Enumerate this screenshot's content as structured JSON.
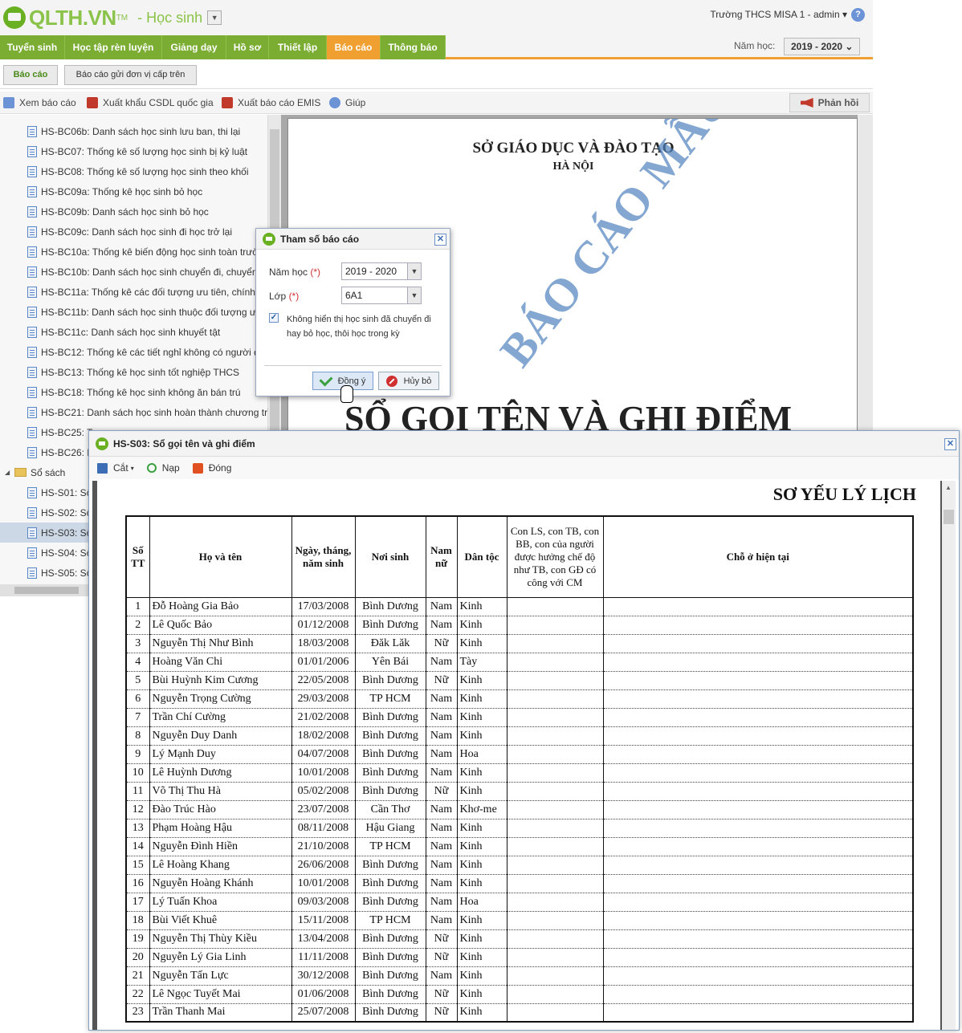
{
  "header": {
    "logo_text": "QLTH.VN",
    "logo_tm": "TM",
    "module": "- Học sinh",
    "role_caret": "▼",
    "user": "Trường THCS MISA 1 - admin ▾",
    "help": "?"
  },
  "nav": {
    "tabs": [
      {
        "label": "Tuyển sinh"
      },
      {
        "label": "Học tập rèn luyện"
      },
      {
        "label": "Giảng dạy"
      },
      {
        "label": "Hồ sơ"
      },
      {
        "label": "Thiết lập"
      },
      {
        "label": "Báo cáo"
      },
      {
        "label": "Thông báo"
      }
    ],
    "active_index": 5,
    "year_label": "Năm học:",
    "year_value": "2019 - 2020 ⌄"
  },
  "subtabs": [
    "Báo cáo",
    "Báo cáo gửi đơn vị cấp trên"
  ],
  "toolbar": {
    "view": "Xem báo cáo",
    "export_db": "Xuất khẩu CSDL quốc gia",
    "export_emis": "Xuất báo cáo EMIS",
    "help": "Giúp",
    "feedback": "Phản hồi"
  },
  "tree": {
    "items": [
      {
        "label": "HS-BC06b: Danh sách học sinh lưu ban, thi lại"
      },
      {
        "label": "HS-BC07: Thống kê số lượng học sinh bị kỷ luật"
      },
      {
        "label": "HS-BC08: Thống kê số lượng học sinh theo khối"
      },
      {
        "label": "HS-BC09a: Thống kê học sinh bỏ học"
      },
      {
        "label": "HS-BC09b: Danh sách học sinh bỏ học"
      },
      {
        "label": "HS-BC09c: Danh sách học sinh đi học trở lại"
      },
      {
        "label": "HS-BC10a: Thống kê biến động học sinh toàn trườ"
      },
      {
        "label": "HS-BC10b: Danh sách học sinh chuyển đi, chuyển"
      },
      {
        "label": "HS-BC11a: Thống kê các đối tượng ưu tiên, chính s"
      },
      {
        "label": "HS-BC11b: Danh sách học sinh thuộc đối tượng ưu"
      },
      {
        "label": "HS-BC11c: Danh sách học sinh khuyết tật"
      },
      {
        "label": "HS-BC12: Thống kê các tiết nghỉ không có người d"
      },
      {
        "label": "HS-BC13: Thống kê học sinh tốt nghiệp THCS"
      },
      {
        "label": "HS-BC18: Thống kê học sinh không ăn bán trú"
      },
      {
        "label": "HS-BC21: Danh sách học sinh hoàn thành chương trìr"
      },
      {
        "label": "HS-BC25: T"
      },
      {
        "label": "HS-BC26: D"
      }
    ],
    "folder": {
      "label": "Sổ sách",
      "toggle": "◢"
    },
    "folder_items": [
      {
        "label": "HS-S01: Số"
      },
      {
        "label": "HS-S02: Số"
      },
      {
        "label": "HS-S03: Số"
      },
      {
        "label": "HS-S04: Số"
      },
      {
        "label": "HS-S05: Số"
      }
    ],
    "selected": "HS-S03"
  },
  "preview": {
    "dept": "SỞ GIÁO DỤC VÀ ĐÀO TẠO",
    "city": "HÀ NỘI",
    "watermark": "BÁO CÁO MẪU",
    "title": "SỔ GỌI TÊN VÀ GHI ĐIỂM"
  },
  "dialog": {
    "title": "Tham số báo cáo",
    "year_label": "Năm học",
    "year_value": "2019 - 2020",
    "class_label": "Lớp",
    "class_value": "6A1",
    "required_mark": "(*)",
    "arrow": "▼",
    "checkbox_mark": "✓",
    "checkbox_text": "Không hiển thị học sinh đã chuyển đi hay bỏ học, thôi học trong kỳ",
    "ok": "Đồng ý",
    "cancel": "Hủy bỏ",
    "close": "✕"
  },
  "window": {
    "title": "HS-S03: Sổ gọi tên và ghi điểm",
    "close": "✕",
    "tools": {
      "cut": "Cắt",
      "caret": "▾",
      "load": "Nạp",
      "close": "Đóng"
    },
    "heading": "SƠ YẾU LÝ LỊCH",
    "scroll_up": "▲",
    "columns": [
      "Số TT",
      "Họ và tên",
      "Ngày, tháng, năm sinh",
      "Nơi sinh",
      "Nam nữ",
      "Dân tộc",
      "Con LS, con TB, con BB, con của người được hưởng chế độ như TB, con GĐ có công với CM",
      "Chỗ ở hiện tại"
    ],
    "rows": [
      {
        "no": "1",
        "name": "Đỗ Hoàng Gia Bảo",
        "dob": "17/03/2008",
        "place": "Bình Dương",
        "sex": "Nam",
        "eth": "Kinh"
      },
      {
        "no": "2",
        "name": "Lê Quốc Bảo",
        "dob": "01/12/2008",
        "place": "Bình Dương",
        "sex": "Nam",
        "eth": "Kinh"
      },
      {
        "no": "3",
        "name": "Nguyễn Thị Như Bình",
        "dob": "18/03/2008",
        "place": "Đăk Lăk",
        "sex": "Nữ",
        "eth": "Kinh"
      },
      {
        "no": "4",
        "name": "Hoàng Văn Chi",
        "dob": "01/01/2006",
        "place": "Yên Bái",
        "sex": "Nam",
        "eth": "Tày"
      },
      {
        "no": "5",
        "name": "Bùi Huỳnh Kim Cương",
        "dob": "22/05/2008",
        "place": "Bình Dương",
        "sex": "Nữ",
        "eth": "Kinh"
      },
      {
        "no": "6",
        "name": "Nguyễn Trọng Cường",
        "dob": "29/03/2008",
        "place": "TP HCM",
        "sex": "Nam",
        "eth": "Kinh"
      },
      {
        "no": "7",
        "name": "Trần Chí Cường",
        "dob": "21/02/2008",
        "place": "Bình Dương",
        "sex": "Nam",
        "eth": "Kinh"
      },
      {
        "no": "8",
        "name": "Nguyễn Duy Danh",
        "dob": "18/02/2008",
        "place": "Bình Dương",
        "sex": "Nam",
        "eth": "Kinh"
      },
      {
        "no": "9",
        "name": "Lý Mạnh Duy",
        "dob": "04/07/2008",
        "place": "Bình Dương",
        "sex": "Nam",
        "eth": "Hoa"
      },
      {
        "no": "10",
        "name": "Lê Huỳnh Dương",
        "dob": "10/01/2008",
        "place": "Bình Dương",
        "sex": "Nam",
        "eth": "Kinh"
      },
      {
        "no": "11",
        "name": "Võ Thị Thu Hà",
        "dob": "05/02/2008",
        "place": "Bình Dương",
        "sex": "Nữ",
        "eth": "Kinh"
      },
      {
        "no": "12",
        "name": "Đào Trúc Hào",
        "dob": "23/07/2008",
        "place": "Cần Thơ",
        "sex": "Nam",
        "eth": "Khơ-me"
      },
      {
        "no": "13",
        "name": "Phạm Hoàng Hậu",
        "dob": "08/11/2008",
        "place": "Hậu Giang",
        "sex": "Nam",
        "eth": "Kinh"
      },
      {
        "no": "14",
        "name": "Nguyễn Đình Hiền",
        "dob": "21/10/2008",
        "place": "TP HCM",
        "sex": "Nam",
        "eth": "Kinh"
      },
      {
        "no": "15",
        "name": "Lê Hoàng Khang",
        "dob": "26/06/2008",
        "place": "Bình Dương",
        "sex": "Nam",
        "eth": "Kinh"
      },
      {
        "no": "16",
        "name": "Nguyễn Hoàng Khánh",
        "dob": "10/01/2008",
        "place": "Bình Dương",
        "sex": "Nam",
        "eth": "Kinh"
      },
      {
        "no": "17",
        "name": "Lý Tuấn Khoa",
        "dob": "09/03/2008",
        "place": "Bình Dương",
        "sex": "Nam",
        "eth": "Hoa"
      },
      {
        "no": "18",
        "name": "Bùi Viết Khuê",
        "dob": "15/11/2008",
        "place": "TP HCM",
        "sex": "Nam",
        "eth": "Kinh"
      },
      {
        "no": "19",
        "name": "Nguyễn Thị Thùy Kiều",
        "dob": "13/04/2008",
        "place": "Bình Dương",
        "sex": "Nữ",
        "eth": "Kinh"
      },
      {
        "no": "20",
        "name": "Nguyễn Lý Gia Linh",
        "dob": "11/11/2008",
        "place": "Bình Dương",
        "sex": "Nữ",
        "eth": "Kinh"
      },
      {
        "no": "21",
        "name": "Nguyễn Tấn Lực",
        "dob": "30/12/2008",
        "place": "Bình Dương",
        "sex": "Nam",
        "eth": "Kinh"
      },
      {
        "no": "22",
        "name": "Lê Ngọc Tuyết Mai",
        "dob": "01/06/2008",
        "place": "Bình Dương",
        "sex": "Nữ",
        "eth": "Kinh"
      },
      {
        "no": "23",
        "name": "Trần Thanh Mai",
        "dob": "25/07/2008",
        "place": "Bình Dương",
        "sex": "Nữ",
        "eth": "Kinh"
      }
    ]
  }
}
